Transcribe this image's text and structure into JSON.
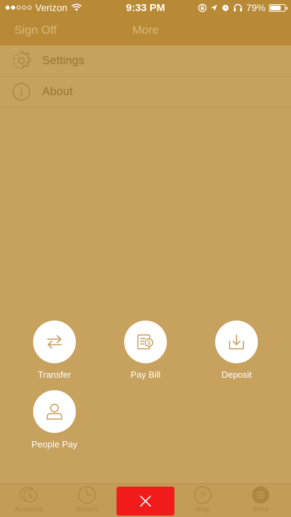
{
  "status_bar": {
    "carrier": "Verizon",
    "time": "9:33 PM",
    "battery": "79%",
    "battery_level": 0.79
  },
  "nav": {
    "left_label": "Sign Off",
    "title": "More"
  },
  "menu": {
    "items": [
      {
        "label": "Settings",
        "icon": "gear-icon"
      },
      {
        "label": "About",
        "icon": "info-icon"
      }
    ]
  },
  "actions": [
    {
      "label": "Transfer",
      "icon": "transfer-arrows-icon"
    },
    {
      "label": "Pay Bill",
      "icon": "bill-icon"
    },
    {
      "label": "Deposit",
      "icon": "deposit-icon"
    },
    {
      "label": "People Pay",
      "icon": "person-icon"
    }
  ],
  "tabs": [
    {
      "label": "Accounts",
      "icon": "dollar-coin-icon"
    },
    {
      "label": "Recent",
      "icon": "clock-icon"
    },
    {
      "label": "Help",
      "icon": "question-icon"
    },
    {
      "label": "More",
      "icon": "menu-icon"
    }
  ],
  "colors": {
    "background": "#c7a15e",
    "header": "#b98a36",
    "close": "#f21b1b"
  }
}
